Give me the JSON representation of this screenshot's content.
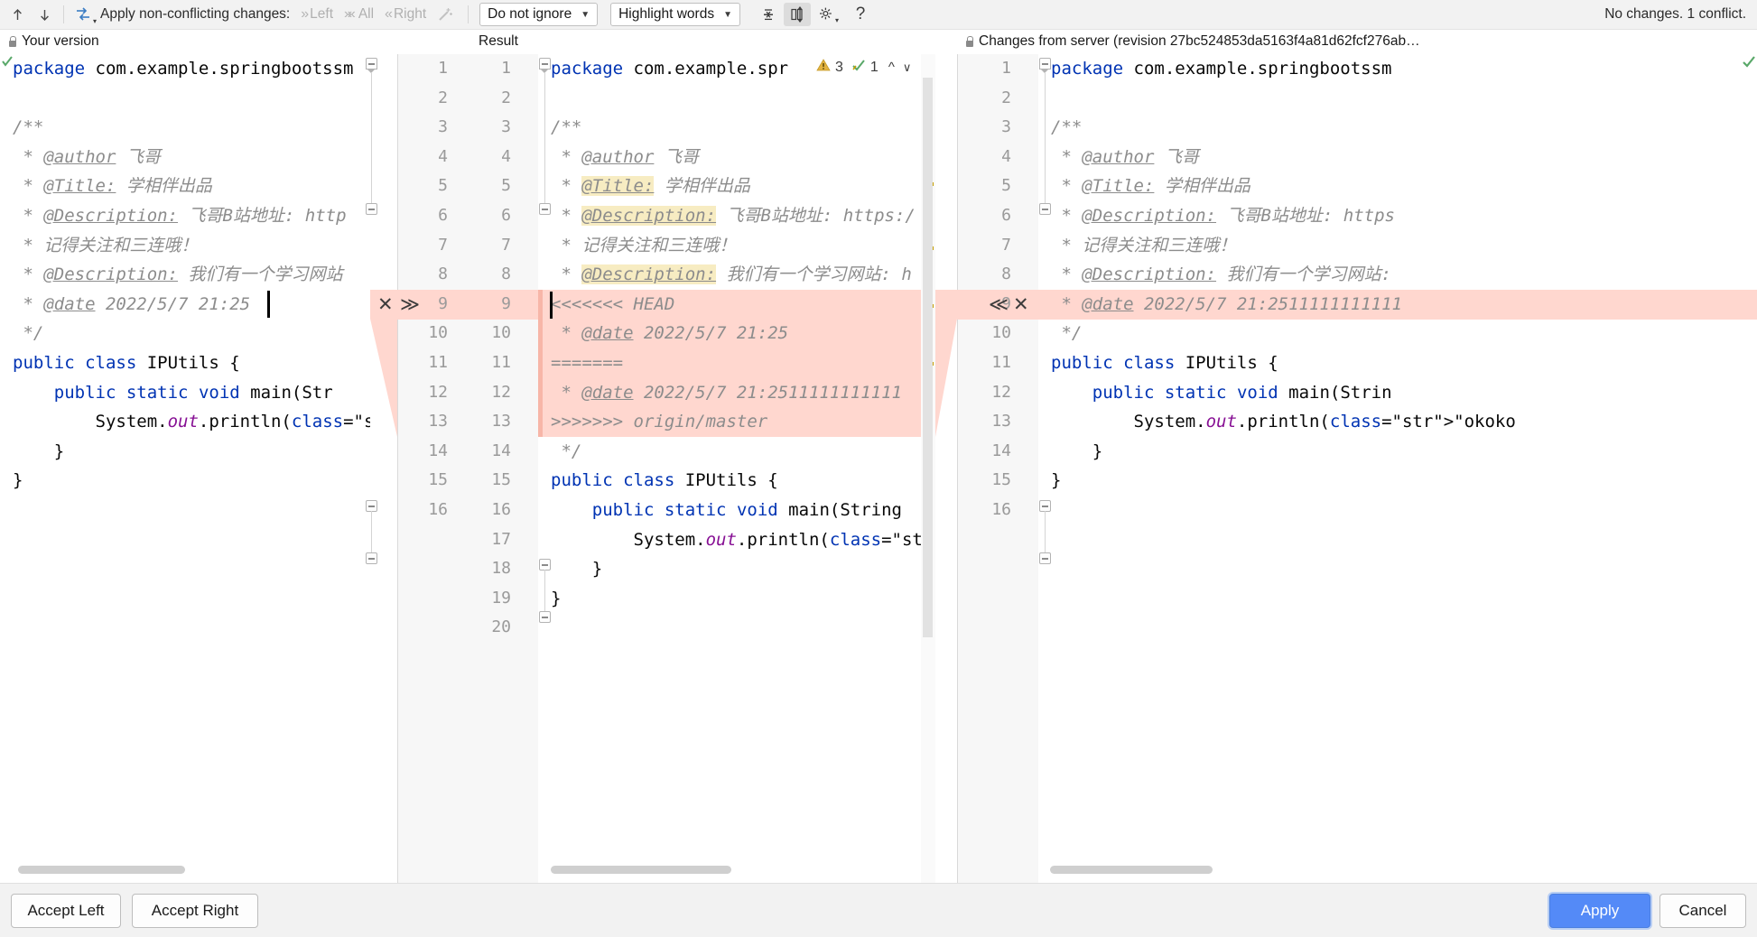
{
  "toolbar": {
    "prev_icon": "arrow-up-icon",
    "next_icon": "arrow-down-icon",
    "compare_icon": "compare-files-icon",
    "apply_label": "Apply non-conflicting changes:",
    "actions": [
      {
        "label": "Left",
        "icon": "chevron-double-right-icon"
      },
      {
        "label": "All",
        "icon": "chevron-double-both-icon"
      },
      {
        "label": "Right",
        "icon": "chevron-double-left-icon"
      }
    ],
    "magic_icon": "magic-wand-icon",
    "ignore_select": "Do not ignore",
    "highlight_select": "Highlight words",
    "collapse_icon": "collapse-unchanged-icon",
    "sync_scroll_icon": "synchronize-scroll-icon",
    "settings_icon": "gear-icon",
    "help_icon": "help-question-icon",
    "status": "No changes. 1 conflict."
  },
  "panes": {
    "left_title": "Your version",
    "mid_title": "Result",
    "right_title": "Changes from server (revision 27bc524853da5163f4a81d62fcf276ab…"
  },
  "inspections": {
    "warning_icon": "warning-triangle-icon",
    "warning_count": "3",
    "weak_icon": "weak-warning-icon",
    "weak_count": "1",
    "up_icon": "caret-up-icon",
    "down_icon": "caret-down-icon"
  },
  "left_editor": {
    "lines": [
      "package com.example.springbootssm",
      "",
      "/**",
      " * @author 飞哥",
      " * @Title: 学相伴出品",
      " * @Description: 飞哥B站地址: http",
      " * 记得关注和三连哦！",
      " * @Description: 我们有一个学习网站",
      " * @date 2022/5/7 21:25",
      " */",
      "public class IPUtils {",
      "    public static void main(Str",
      "        System.out.println(\"okok",
      "    }",
      "}"
    ],
    "conflict_line_index": 8
  },
  "mid_editor": {
    "line_numbers_left": [
      "1",
      "2",
      "3",
      "4",
      "5",
      "6",
      "7",
      "8",
      "9",
      "10",
      "11",
      "12",
      "13",
      "14",
      "15",
      "16"
    ],
    "line_numbers_right": [
      "1",
      "2",
      "3",
      "4",
      "5",
      "6",
      "7",
      "8",
      "9",
      "10",
      "11",
      "12",
      "13",
      "14",
      "15",
      "16",
      "17",
      "18",
      "19",
      "20"
    ],
    "lines": [
      "package com.example.spr",
      "",
      "/**",
      " * @author 飞哥",
      " * @Title: 学相伴出品",
      " * @Description: 飞哥B站地址: https:/",
      " * 记得关注和三连哦！",
      " * @Description: 我们有一个学习网站: h",
      "<<<<<<< HEAD",
      " * @date 2022/5/7 21:25",
      "=======",
      " * @date 2022/5/7 21:2511111111111",
      ">>>>>>> origin/master",
      " */",
      "public class IPUtils {",
      "    public static void main(String",
      "        System.out.println(\"okokok\"",
      "    }",
      "}",
      ""
    ],
    "conflict_action_accept": "✕",
    "conflict_action_apply": "≫"
  },
  "right_editor": {
    "line_numbers": [
      "1",
      "2",
      "3",
      "4",
      "5",
      "6",
      "7",
      "8",
      "9",
      "10",
      "11",
      "12",
      "13",
      "14",
      "15",
      "16"
    ],
    "lines": [
      "package com.example.springbootssm",
      "",
      "/**",
      " * @author 飞哥",
      " * @Title: 学相伴出品",
      " * @Description: 飞哥B站地址: https",
      " * 记得关注和三连哦！",
      " * @Description: 我们有一个学习网站:",
      " * @date 2022/5/7 21:2511111111111",
      " */",
      "public class IPUtils {",
      "    public static void main(Strin",
      "        System.out.println(\"okoko",
      "    }",
      "}",
      ""
    ],
    "conflict_line_index": 8,
    "conflict_action_apply": "≪",
    "conflict_action_accept": "✕"
  },
  "buttons": {
    "accept_left": "Accept Left",
    "accept_right": "Accept Right",
    "apply": "Apply",
    "cancel": "Cancel"
  },
  "colors": {
    "conflict_bg": "#ffd7cf",
    "conflict_bg_soft": "#ffe4dd",
    "search_highlight": "#f7ecc2",
    "keyword": "#0033b3",
    "string": "#067d17",
    "comment": "#8c8c8c",
    "primary_button": "#548af7",
    "marker_yellow": "#c8a000"
  }
}
